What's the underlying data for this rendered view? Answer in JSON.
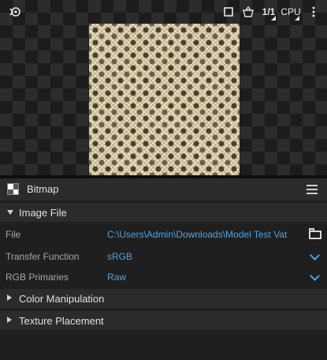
{
  "toolbar": {
    "ratio_label": "1/1",
    "device_label": "CPU",
    "icons": [
      "logo-icon",
      "square-icon",
      "basket-icon",
      "kebab-menu-icon"
    ]
  },
  "panel": {
    "title": "Bitmap",
    "image_file_section": "Image File",
    "properties": [
      {
        "key": "File",
        "value": "C:\\Users\\Admin\\Downloads\\Model Test Vat"
      },
      {
        "key": "Transfer Function",
        "value": "sRGB"
      },
      {
        "key": "RGB Primaries",
        "value": "Raw"
      }
    ],
    "color_section": "Color Manipulation",
    "texture_section": "Texture Placement"
  },
  "colors": {
    "accent": "#4fa3e6",
    "panel_bg": "#1f1f1f",
    "section_bg": "#2b2b2b"
  }
}
